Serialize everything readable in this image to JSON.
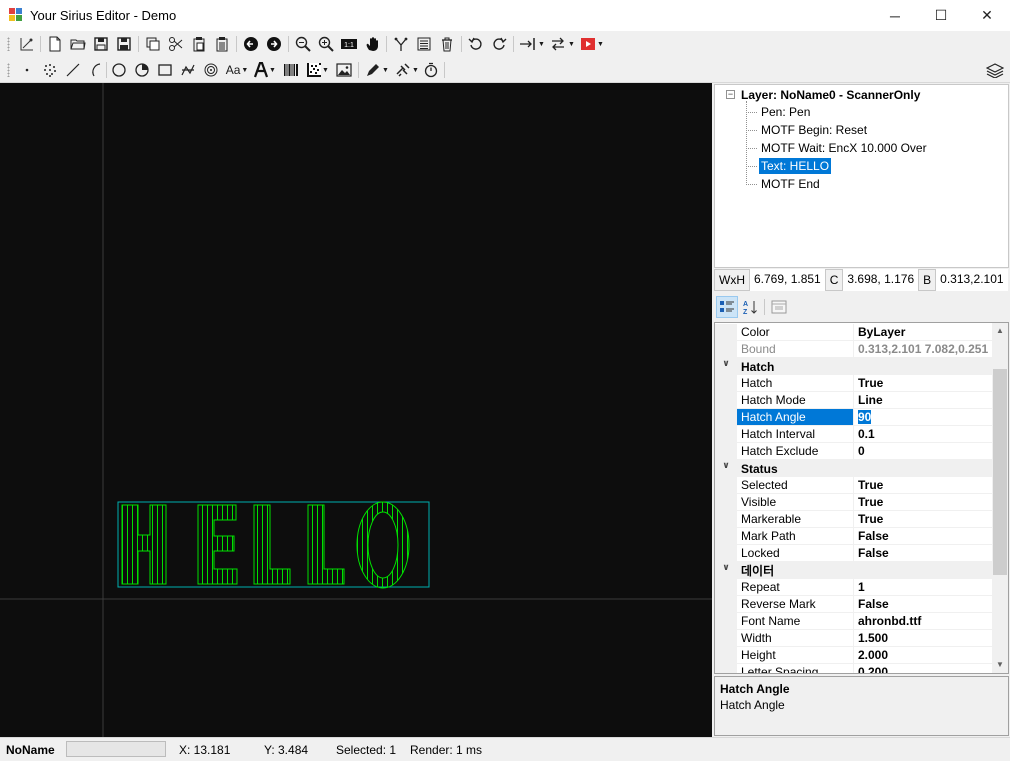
{
  "window": {
    "title": "Your Sirius Editor - Demo",
    "controls": {
      "minimize": "─",
      "maximize": "☐",
      "close": "✕"
    }
  },
  "toolbar1": [
    "axis-icon",
    "new-file-icon",
    "open-folder-icon",
    "save-icon",
    "save-as-icon",
    "copy-icon",
    "cut-icon",
    "paste-icon",
    "paste-array-icon",
    "arrow-left-icon",
    "arrow-right-icon",
    "zoom-out-icon",
    "zoom-in-icon",
    "zoom-fit-icon",
    "pan-hand-icon",
    "explode-icon",
    "list-icon",
    "delete-icon",
    "undo-icon",
    "redo-icon",
    "align-icon",
    "arrange-icon",
    "mark-icon"
  ],
  "toolbar2": {
    "text_button_label": "Aa",
    "icons": [
      "point-icon",
      "points-icon",
      "line-icon",
      "arc-icon",
      "circle-icon",
      "trepan-icon",
      "rectangle-icon",
      "spiral-icon",
      "spiral-circle-icon",
      "text-icon",
      "big-text-icon",
      "barcode-icon",
      "datamatrix-icon",
      "image-icon",
      "pen-icon",
      "laser-icon",
      "timer-icon",
      "layers-icon"
    ]
  },
  "tree": {
    "root": "Layer: NoName0 - ScannerOnly",
    "items": [
      {
        "label": "Pen: Pen",
        "selected": false
      },
      {
        "label": "MOTF Begin: Reset",
        "selected": false
      },
      {
        "label": "MOTF Wait: EncX 10.000 Over",
        "selected": false
      },
      {
        "label": "Text: HELLO",
        "selected": true
      },
      {
        "label": "MOTF End",
        "selected": false
      }
    ]
  },
  "infobar": {
    "wxh_label": "WxH",
    "wxh_value": "6.769, 1.851",
    "c_label": "C",
    "c_value": "3.698, 1.176",
    "b_label": "B",
    "b_value": "0.313,2.101"
  },
  "properties": [
    {
      "kind": "row",
      "name": "Color",
      "value": "ByLayer"
    },
    {
      "kind": "row",
      "name": "Bound",
      "value": "0.313,2.101 7.082,0.251",
      "disabled": true
    },
    {
      "kind": "category",
      "name": "Hatch"
    },
    {
      "kind": "row",
      "name": "Hatch",
      "value": "True"
    },
    {
      "kind": "row",
      "name": "Hatch Mode",
      "value": "Line"
    },
    {
      "kind": "row",
      "name": "Hatch Angle",
      "value": "90",
      "selected": true
    },
    {
      "kind": "row",
      "name": "Hatch Interval",
      "value": "0.1"
    },
    {
      "kind": "row",
      "name": "Hatch Exclude",
      "value": "0"
    },
    {
      "kind": "category",
      "name": "Status"
    },
    {
      "kind": "row",
      "name": "Selected",
      "value": "True"
    },
    {
      "kind": "row",
      "name": "Visible",
      "value": "True"
    },
    {
      "kind": "row",
      "name": "Markerable",
      "value": "True"
    },
    {
      "kind": "row",
      "name": "Mark Path",
      "value": "False"
    },
    {
      "kind": "row",
      "name": "Locked",
      "value": "False"
    },
    {
      "kind": "category",
      "name": "데이터"
    },
    {
      "kind": "row",
      "name": "Repeat",
      "value": "1"
    },
    {
      "kind": "row",
      "name": "Reverse Mark",
      "value": "False"
    },
    {
      "kind": "row",
      "name": "Font Name",
      "value": "ahronbd.ttf"
    },
    {
      "kind": "row",
      "name": "Width",
      "value": "1.500"
    },
    {
      "kind": "row",
      "name": "Height",
      "value": "2.000"
    },
    {
      "kind": "row",
      "name": "Letter Spacing",
      "value": "0.200"
    }
  ],
  "help": {
    "title": "Hatch Angle",
    "description": "Hatch Angle"
  },
  "canvas": {
    "text": "HELLO",
    "colors": {
      "background": "#0d0d0d",
      "entity": "#00e000",
      "bound": "#00b0b0",
      "axis": "#3c3c3c"
    }
  },
  "status": {
    "document": "NoName",
    "x": "X: 13.181",
    "y": "Y: 3.484",
    "selected": "Selected: 1",
    "render": "Render: 1 ms"
  },
  "colors": {
    "selection": "#0078d7",
    "panel": "#f0f0f0"
  }
}
